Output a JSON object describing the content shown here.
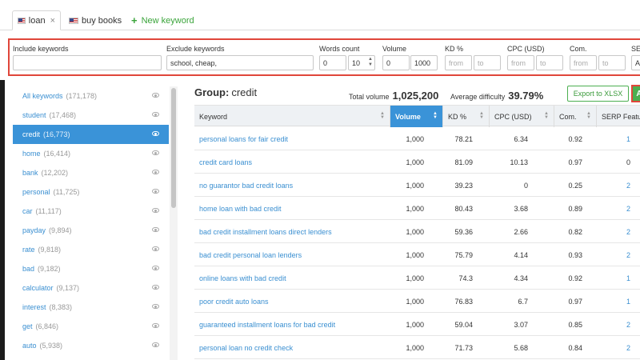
{
  "tabs": [
    {
      "label": "loan",
      "close": "×"
    },
    {
      "label": "buy books"
    },
    {
      "label": "New keyword",
      "plus": "+"
    }
  ],
  "filters": {
    "include": {
      "label": "Include keywords",
      "value": ""
    },
    "exclude": {
      "label": "Exclude keywords",
      "value": "school, cheap,"
    },
    "words": {
      "label": "Words count",
      "from": "0",
      "to": "10"
    },
    "volume": {
      "label": "Volume",
      "from": "0",
      "to": "1000"
    },
    "kd": {
      "label": "KD %",
      "from": "from",
      "to": "to"
    },
    "cpc": {
      "label": "CPC (USD)",
      "from": "from",
      "to": "to"
    },
    "com": {
      "label": "Com.",
      "from": "from",
      "to": "to"
    },
    "serp": {
      "label": "SERP",
      "value": "An"
    }
  },
  "sidebar": {
    "items": [
      {
        "label": "All keywords",
        "count": "(171,178)"
      },
      {
        "label": "student",
        "count": "(17,468)"
      },
      {
        "label": "credit",
        "count": "(16,773)"
      },
      {
        "label": "home",
        "count": "(16,414)"
      },
      {
        "label": "bank",
        "count": "(12,202)"
      },
      {
        "label": "personal",
        "count": "(11,725)"
      },
      {
        "label": "car",
        "count": "(11,117)"
      },
      {
        "label": "payday",
        "count": "(9,894)"
      },
      {
        "label": "rate",
        "count": "(9,818)"
      },
      {
        "label": "bad",
        "count": "(9,182)"
      },
      {
        "label": "calculator",
        "count": "(9,137)"
      },
      {
        "label": "interest",
        "count": "(8,383)"
      },
      {
        "label": "get",
        "count": "(6,846)"
      },
      {
        "label": "auto",
        "count": "(5,938)"
      }
    ]
  },
  "group": {
    "label": "Group:",
    "name": "credit",
    "total_volume_label": "Total volume",
    "total_volume": "1,025,200",
    "avg_difficulty_label": "Average difficulty",
    "avg_difficulty": "39.79%"
  },
  "buttons": {
    "export": "Export to XLSX",
    "add": "A"
  },
  "table": {
    "headers": [
      "Keyword",
      "Volume",
      "KD %",
      "CPC (USD)",
      "Com.",
      "SERP Featur"
    ],
    "rows": [
      {
        "keyword": "personal loans for fair credit",
        "volume": "1,000",
        "kd": "78.21",
        "cpc": "6.34",
        "com": "0.92",
        "serp": "1"
      },
      {
        "keyword": "credit card loans",
        "volume": "1,000",
        "kd": "81.09",
        "cpc": "10.13",
        "com": "0.97",
        "serp": "0"
      },
      {
        "keyword": "no guarantor bad credit loans",
        "volume": "1,000",
        "kd": "39.23",
        "cpc": "0",
        "com": "0.25",
        "serp": "2"
      },
      {
        "keyword": "home loan with bad credit",
        "volume": "1,000",
        "kd": "80.43",
        "cpc": "3.68",
        "com": "0.89",
        "serp": "2"
      },
      {
        "keyword": "bad credit installment loans direct lenders",
        "volume": "1,000",
        "kd": "59.36",
        "cpc": "2.66",
        "com": "0.82",
        "serp": "2"
      },
      {
        "keyword": "bad credit personal loan lenders",
        "volume": "1,000",
        "kd": "75.79",
        "cpc": "4.14",
        "com": "0.93",
        "serp": "2"
      },
      {
        "keyword": "online loans with bad credit",
        "volume": "1,000",
        "kd": "74.3",
        "cpc": "4.34",
        "com": "0.92",
        "serp": "1"
      },
      {
        "keyword": "poor credit auto loans",
        "volume": "1,000",
        "kd": "76.83",
        "cpc": "6.7",
        "com": "0.97",
        "serp": "1"
      },
      {
        "keyword": "guaranteed installment loans for bad credit",
        "volume": "1,000",
        "kd": "59.04",
        "cpc": "3.07",
        "com": "0.85",
        "serp": "2"
      },
      {
        "keyword": "personal loan no credit check",
        "volume": "1,000",
        "kd": "71.73",
        "cpc": "5.68",
        "com": "0.84",
        "serp": "2"
      }
    ]
  },
  "colors": {
    "accent": "#3a93d8",
    "highlight": "#e0463a",
    "green": "#4caf50",
    "link": "#3a8fd1"
  }
}
